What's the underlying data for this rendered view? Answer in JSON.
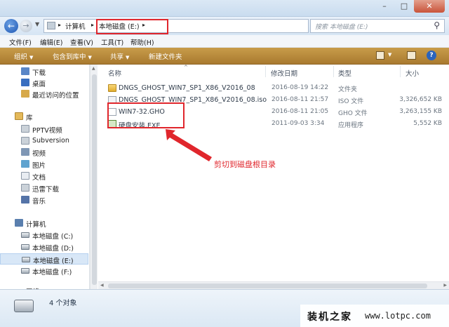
{
  "address": {
    "crumbs": [
      "计算机",
      "本地磁盘 (E:)"
    ],
    "search_placeholder": "搜索 本地磁盘 (E:)"
  },
  "menu": [
    "文件(F)",
    "编辑(E)",
    "查看(V)",
    "工具(T)",
    "帮助(H)"
  ],
  "toolbar": {
    "organize": "组织",
    "include_library": "包含到库中",
    "share": "共享",
    "new_folder": "新建文件夹"
  },
  "nav": {
    "favorites": [
      "下载",
      "桌面",
      "最近访问的位置"
    ],
    "library_header": "库",
    "libraries": [
      "PPTV视频",
      "Subversion",
      "视频",
      "图片",
      "文档",
      "迅雷下载",
      "音乐"
    ],
    "computer_header": "计算机",
    "drives": [
      "本地磁盘 (C:)",
      "本地磁盘 (D:)",
      "本地磁盘 (E:)",
      "本地磁盘 (F:)"
    ],
    "network_partial": "网络"
  },
  "columns": {
    "name": "名称",
    "date": "修改日期",
    "type": "类型",
    "size": "大小"
  },
  "files": [
    {
      "name": "DNGS_GHOST_WIN7_SP1_X86_V2016_08",
      "date": "2016-08-19 14:22",
      "type": "文件夹",
      "size": "",
      "icon": "folder"
    },
    {
      "name": "DNGS_GHOST_WIN7_SP1_X86_V2016_08.iso",
      "date": "2016-08-11 21:57",
      "type": "ISO 文件",
      "size": "3,326,652 KB",
      "icon": "iso"
    },
    {
      "name": "WIN7-32.GHO",
      "date": "2016-08-11 21:05",
      "type": "GHO 文件",
      "size": "3,263,155 KB",
      "icon": "gho"
    },
    {
      "name": "硬盘安装.EXE",
      "date": "2011-09-03 3:34",
      "type": "应用程序",
      "size": "5,552 KB",
      "icon": "exe"
    }
  ],
  "annotation": "剪切到磁盘根目录",
  "status": "4 个对象",
  "watermark": {
    "cn": "装机之家",
    "en": "www.lotpc.com"
  },
  "colors": {
    "toolbar": "#b88a3c",
    "highlight": "#e0262c",
    "selected": "#d8e7f7"
  }
}
